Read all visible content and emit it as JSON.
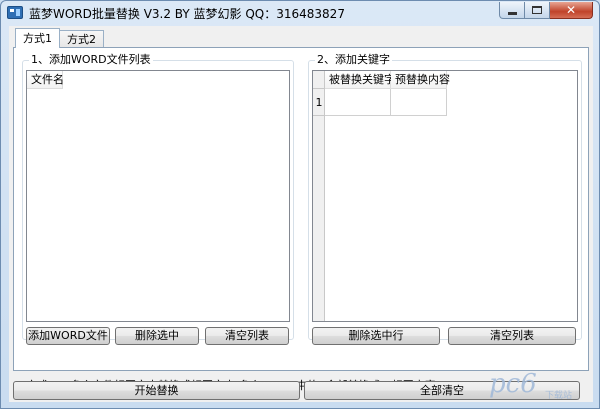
{
  "window": {
    "title": "蓝梦WORD批量替换 V3.2 BY 蓝梦幻影 QQ：316483827"
  },
  "tabs": [
    {
      "label": "方式1",
      "active": true
    },
    {
      "label": "方式2",
      "active": false
    }
  ],
  "left_group": {
    "label": "1、添加WORD文件列表",
    "list_header": "文件名",
    "buttons": {
      "add": "添加WORD文件",
      "remove": "删除选中",
      "clear": "清空列表"
    }
  },
  "right_group": {
    "label": "2、添加关键字",
    "columns": [
      "被替换关键字",
      "预替换内容"
    ],
    "rows": [
      {
        "num": "1",
        "keyword": "",
        "replacement": ""
      }
    ],
    "buttons": {
      "remove_row": "删除选中行",
      "clear": "清空列表"
    }
  },
  "description": "方式一：多个文件相同文本替换成相同文本   多个WORD中的A全部替换成B 相同内容",
  "bottom_buttons": {
    "start": "开始替换",
    "clear_all": "全部清空"
  },
  "watermark": {
    "text": "pc6",
    "subtext": "下载站"
  },
  "colors": {
    "watermark": "#9fb8d8"
  }
}
